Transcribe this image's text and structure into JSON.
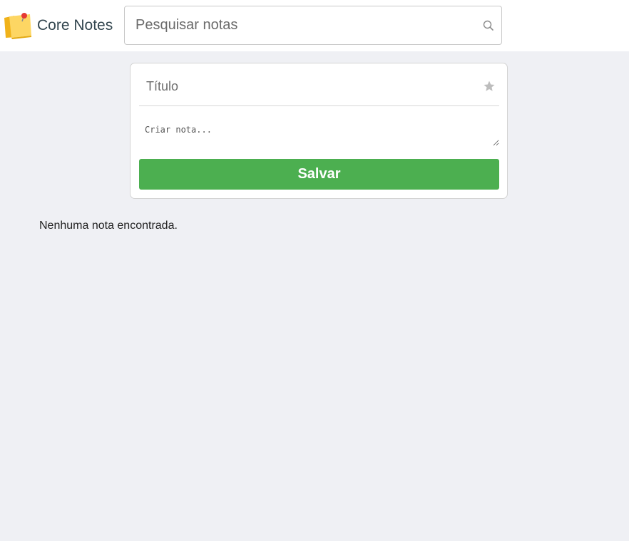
{
  "app": {
    "name": "Core Notes"
  },
  "search": {
    "placeholder": "Pesquisar notas",
    "value": ""
  },
  "note_form": {
    "title_placeholder": "Título",
    "body_placeholder": "Criar nota...",
    "save_label": "Salvar"
  },
  "notes": {
    "empty_message": "Nenhuma nota encontrada."
  },
  "colors": {
    "accent": "#4caf50",
    "background": "#eff0f4",
    "star": "#bdbdbd"
  },
  "icons": {
    "logo": "sticky-note-pin-icon",
    "search": "search-icon",
    "favorite": "star-icon"
  }
}
